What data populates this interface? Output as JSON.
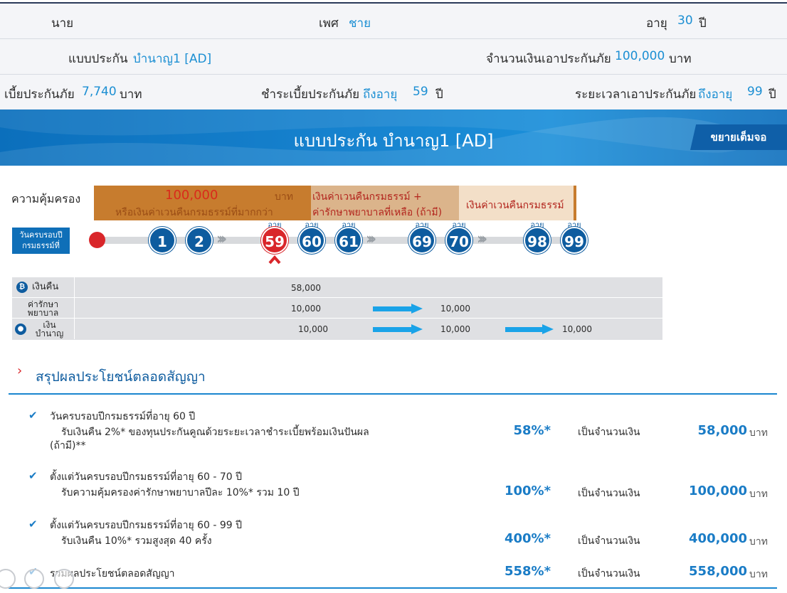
{
  "info": {
    "title_label": "นาย",
    "gender_label": "เพศ",
    "gender_value": "ชาย",
    "age_label": "อายุ",
    "age_value": "30",
    "age_unit": "ปี",
    "plan_label": "แบบประกัน",
    "plan_value": "บำนาญ1 [AD]",
    "sum_label": "จำนวนเงินเอาประกันภัย",
    "sum_value": "100,000",
    "sum_unit": "บาท",
    "premium_label": "เบี้ยประกันภัย",
    "premium_value": "7,740",
    "premium_unit": "บาท",
    "pay_label": "ชำระเบี้ยประกันภัย",
    "pay_value_prefix": "ถึงอายุ",
    "pay_value": "59",
    "pay_unit": "ปี",
    "term_label": "ระยะเวลาเอาประกันภัย",
    "term_value_prefix": "ถึงอายุ",
    "term_value": "99",
    "term_unit": "ปี"
  },
  "banner": {
    "title": "แบบประกัน บำนาญ1 [AD]",
    "fullscreen_label": "ขยายเต็มจอ"
  },
  "coverage": {
    "label": "ความคุ้มครอง",
    "seg1_amount": "100,000",
    "seg1_unit": "บาท",
    "seg1_sub": "หรือเงินค่าเวนคืนกรมธรรม์ที่มากกว่า",
    "seg2_line1": "เงินค่าเวนคืนกรมธรรม์ +",
    "seg2_line2": "ค่ารักษาพยาบาลที่เหลือ (ถ้ามี)",
    "seg3_line1": "เงินค่าเวนคืนกรมธรรม์"
  },
  "timeline": {
    "anniv_line1": "วันครบรอบปี",
    "anniv_line2": "กรมธรรม์ที่",
    "age_tag": "อายุ",
    "years": [
      "1",
      "2"
    ],
    "ages": [
      "59",
      "60",
      "61",
      "69",
      "70",
      "98",
      "99"
    ]
  },
  "benefits": {
    "rows": [
      {
        "name": "เงินคืน",
        "v1": "58,000"
      },
      {
        "name_l1": "ค่ารักษา",
        "name_l2": "พยาบาล",
        "v1": "10,000",
        "v2": "10,000"
      },
      {
        "name_l1": "เงิน",
        "name_l2": "บำนาญ",
        "v1": "10,000",
        "v2": "10,000",
        "v3": "10,000"
      }
    ]
  },
  "summary": {
    "title": "สรุปผลประโยชน์ตลอดสัญญา",
    "as_amount": "เป็นจำนวนเงิน",
    "baht": "บาท",
    "items": [
      {
        "head": "วันครบรอบปีกรมธรรม์ที่อายุ 60 ปี",
        "sub1": "รับเงินคืน 2%* ของทุนประกันคูณด้วยระยะเวลาชำระเบี้ยพร้อมเงินปันผล",
        "sub2": "(ถ้ามี)**",
        "pct": "58%*",
        "amount": "58,000"
      },
      {
        "head": "ตั้งแต่วันครบรอบปีกรมธรรม์ที่อายุ 60 - 70 ปี",
        "sub1": "รับความคุ้มครองค่ารักษาพยาบาลปีละ 10%* รวม 10 ปี",
        "pct": "100%*",
        "amount": "100,000"
      },
      {
        "head": "ตั้งแต่วันครบรอบปีกรมธรรม์ที่อายุ 60 - 99 ปี",
        "sub1": "รับเงินคืน 10%* รวมสูงสุด 40 ครั้ง",
        "pct": "400%*",
        "amount": "400,000"
      },
      {
        "head": "รวมผลประโยชน์ตลอดสัญญา",
        "pct": "558%*",
        "amount": "558,000"
      }
    ]
  },
  "colors": {
    "accent": "#1a7cc6",
    "navy": "#0e5c9f",
    "red": "#d9262a",
    "coverage_dark": "#c77c2e"
  }
}
